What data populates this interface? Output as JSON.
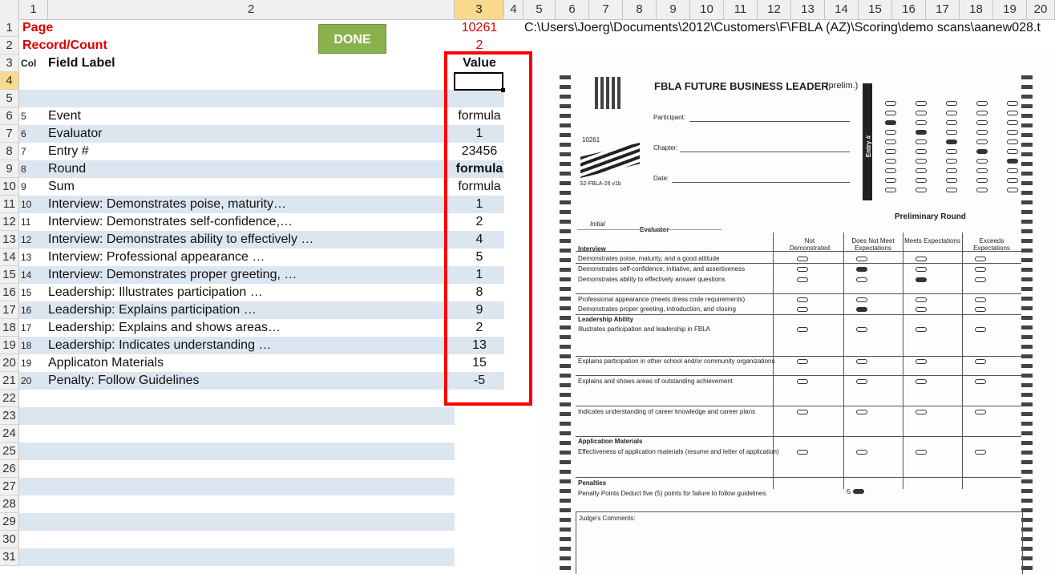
{
  "columns": [
    "1",
    "2",
    "3",
    "4",
    "5",
    "6",
    "7",
    "8",
    "9",
    "10",
    "11",
    "12",
    "13",
    "14",
    "15",
    "16",
    "17",
    "18",
    "19",
    "20"
  ],
  "rows": [
    "1",
    "2",
    "3",
    "4",
    "5",
    "6",
    "7",
    "8",
    "9",
    "10",
    "11",
    "12",
    "13",
    "14",
    "15",
    "16",
    "17",
    "18",
    "19",
    "20",
    "21",
    "22",
    "23",
    "24",
    "25",
    "26",
    "27",
    "28",
    "29",
    "30",
    "31"
  ],
  "sheet": {
    "page_label": "Page",
    "page_value": "10261",
    "record_label": "Record/Count",
    "record_value": "2",
    "col_header": "Col",
    "field_header": "Field Label",
    "value_header": "Value",
    "file_path": "C:\\Users\\Joerg\\Documents\\2012\\Customers\\F\\FBLA (AZ)\\Scoring\\demo scans\\aanew028.t",
    "done_button": "DONE",
    "fields": [
      {
        "col": "5",
        "label": "Event",
        "value": "formula"
      },
      {
        "col": "6",
        "label": "Evaluator",
        "value": "1"
      },
      {
        "col": "7",
        "label": "Entry #",
        "value": "23456"
      },
      {
        "col": "8",
        "label": "Round",
        "value": "formula"
      },
      {
        "col": "9",
        "label": "Sum",
        "value": "formula"
      },
      {
        "col": "10",
        "label": "Interview: Demonstrates poise, maturity…",
        "value": "1"
      },
      {
        "col": "11",
        "label": "Interview: Demonstrates self-confidence,…",
        "value": "2"
      },
      {
        "col": "12",
        "label": "Interview: Demonstrates ability to effectively …",
        "value": "4"
      },
      {
        "col": "13",
        "label": "Interview: Professional appearance …",
        "value": "5"
      },
      {
        "col": "14",
        "label": "Interview: Demonstrates proper greeting, …",
        "value": "1"
      },
      {
        "col": "15",
        "label": "Leadership: Illustrates participation …",
        "value": "8"
      },
      {
        "col": "16",
        "label": "Leadership: Explains participation …",
        "value": "9"
      },
      {
        "col": "17",
        "label": "Leadership: Explains and shows areas…",
        "value": "2"
      },
      {
        "col": "18",
        "label": "Leadership: Indicates understanding …",
        "value": "13"
      },
      {
        "col": "19",
        "label": "Applicaton Materials",
        "value": "15"
      },
      {
        "col": "20",
        "label": "Penalty: Follow Guidelines",
        "value": "-5"
      }
    ]
  },
  "scan": {
    "title": "FBLA FUTURE BUSINESS LEADER",
    "prelim": "(prelim.)",
    "form_id": "10261",
    "form_code": "S2-FBLA-26 v1b",
    "participant": "Participant:",
    "chapter": "Chapter:",
    "date": "Date:",
    "entry": "Entry #",
    "initial": "Initial",
    "evaluator": "Evaluator",
    "round": "Preliminary Round",
    "h_not": "Not Demonstrated",
    "h_dnm": "Does Not Meet Expectations",
    "h_meets": "Meets Expectations",
    "h_exceeds": "Exceeds Expectations",
    "interview": "Interview",
    "i1": "Demonstrates poise, maturity, and a good attitude",
    "i2": "Demonstrates self-confidence, initiative, and assertiveness",
    "i3": "Demonstrates ability to effectively answer questions",
    "i4": "Professional appearance (meets dress code requirements)",
    "i5": "Demonstrates proper greeting, introduction, and closing",
    "leadership": "Leadership Ability",
    "l1": "Illustrates participation and leadership in FBLA",
    "l2": "Explains participation in other school and/or community organizations",
    "l3": "Explains and shows areas of outstanding achievement",
    "l4": "Indicates understanding of career knowledge and career plans",
    "app": "Application Materials",
    "a1": "Effectiveness of application materials (resume and letter of application)",
    "penalties": "Penalties",
    "p1": "Penalty Points Deduct five (5) points for failure to follow guidelines.",
    "penalty_val": "-5",
    "comments": "Judge's Comments:"
  },
  "colors": {
    "accent_red": "#e00000",
    "done_green": "#8ab24c",
    "band_blue": "#dce6f1",
    "selection": "#f9d98c"
  }
}
